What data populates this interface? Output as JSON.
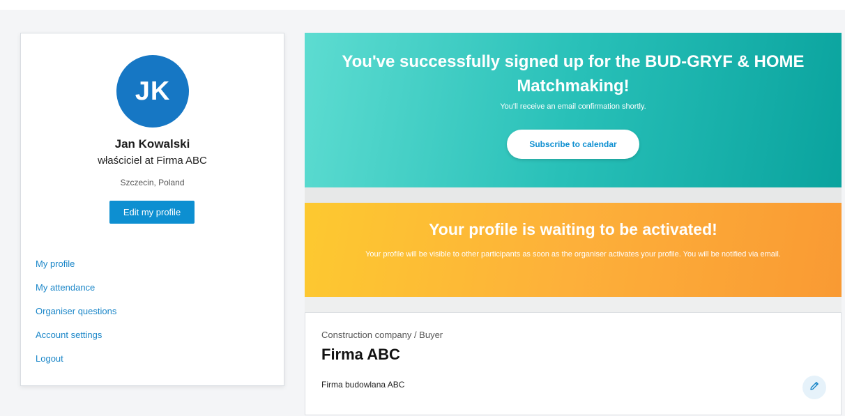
{
  "profile": {
    "initials": "JK",
    "name": "Jan Kowalski",
    "role": "właściciel at Firma ABC",
    "location": "Szczecin, Poland",
    "edit_label": "Edit my profile"
  },
  "nav": {
    "items": [
      {
        "label": "My profile"
      },
      {
        "label": "My attendance"
      },
      {
        "label": "Organiser questions"
      },
      {
        "label": "Account settings"
      },
      {
        "label": "Logout"
      }
    ]
  },
  "success_banner": {
    "title": "You've successfully signed up for the BUD-GRYF & HOME Matchmaking!",
    "subtitle": "You'll receive an email confirmation shortly.",
    "button_label": "Subscribe to calendar"
  },
  "waiting_banner": {
    "title": "Your profile is waiting to be activated!",
    "text": "Your profile will be visible to other participants as soon as the organiser activates your profile. You will be notified via email."
  },
  "company": {
    "type": "Construction company / Buyer",
    "name": "Firma ABC",
    "description": "Firma budowlana ABC"
  },
  "colors": {
    "accent": "#0d8fd1",
    "avatar": "#1677c4",
    "success_gradient": [
      "#5ddcd1",
      "#0aa39e"
    ],
    "warning_gradient": [
      "#fdc930",
      "#f99a33"
    ]
  },
  "icons": {
    "edit_company": "pencil-icon"
  }
}
